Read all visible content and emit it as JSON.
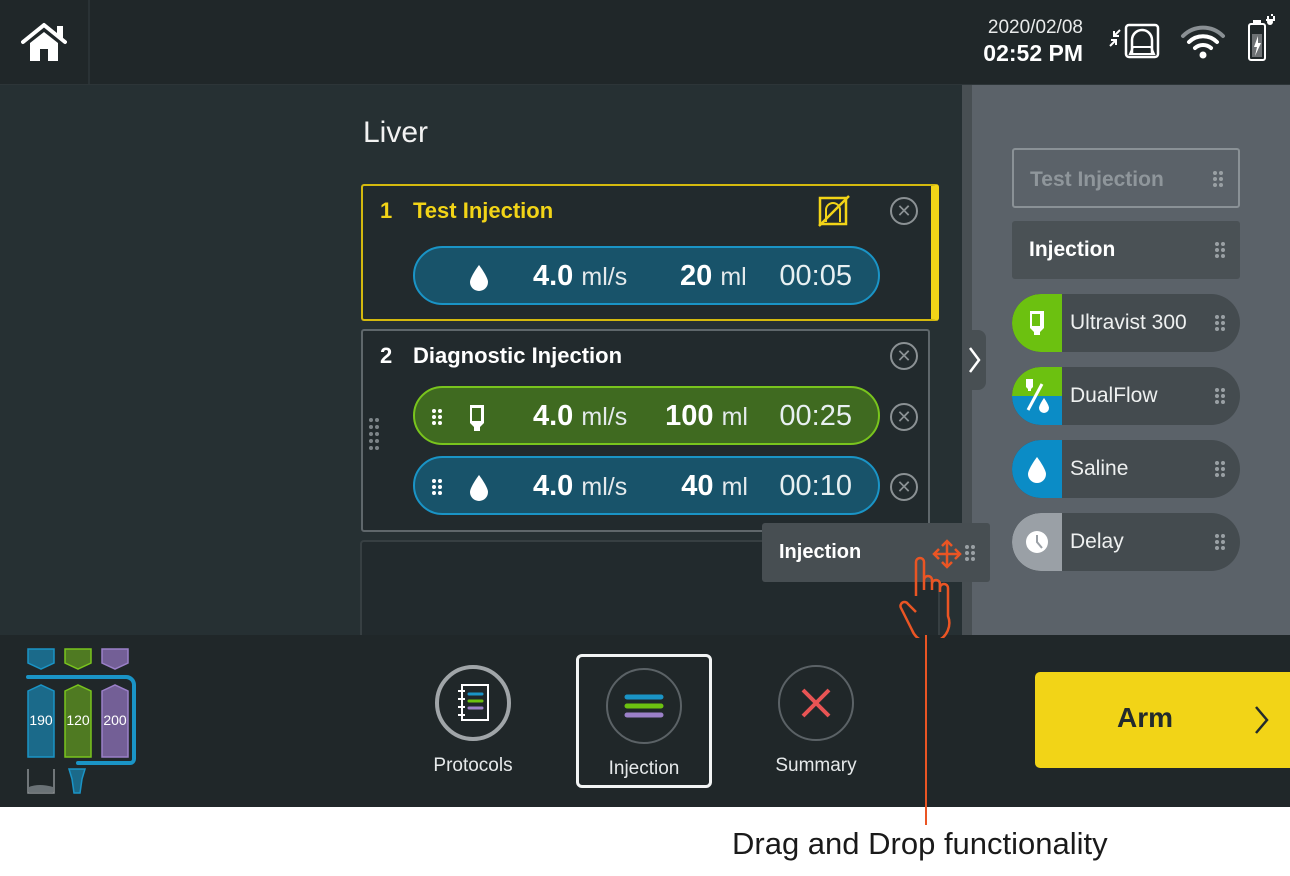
{
  "topbar": {
    "home_icon": "home-icon",
    "date": "2020/02/08",
    "time": "02:52 PM",
    "status_icons": [
      "scanner-link-icon",
      "wifi-icon",
      "battery-charging-icon"
    ]
  },
  "protocol": {
    "title": "Liver",
    "steps": [
      {
        "number": "1",
        "name": "Test Injection",
        "scanner_disabled_icon": "scanner-off-icon",
        "phases": [
          {
            "type": "saline",
            "flow_value": "4.0",
            "flow_unit": "ml/s",
            "volume_value": "20",
            "volume_unit": "ml",
            "duration": "00:05"
          }
        ]
      },
      {
        "number": "2",
        "name": "Diagnostic Injection",
        "phases": [
          {
            "type": "contrast",
            "flow_value": "4.0",
            "flow_unit": "ml/s",
            "volume_value": "100",
            "volume_unit": "ml",
            "duration": "00:25"
          },
          {
            "type": "saline",
            "flow_value": "4.0",
            "flow_unit": "ml/s",
            "volume_value": "40",
            "volume_unit": "ml",
            "duration": "00:10"
          }
        ]
      }
    ]
  },
  "library": {
    "items": [
      {
        "label": "Test Injection",
        "state": "disabled"
      },
      {
        "label": "Injection"
      },
      {
        "label": "Ultravist 300",
        "color": "#6cc110"
      },
      {
        "label": "DualFlow",
        "color_top": "#6cc110",
        "color_bottom": "#0b8cc6"
      },
      {
        "label": "Saline",
        "color": "#0b8cc6"
      },
      {
        "label": "Delay",
        "color": "#9aa0a6"
      }
    ]
  },
  "dragged_item": {
    "label": "Injection"
  },
  "fluid_status": {
    "syringes": [
      {
        "value": "190",
        "color": "#1b6a8a"
      },
      {
        "value": "120",
        "color": "#4f7a22"
      },
      {
        "value": "200",
        "color": "#735f96"
      }
    ]
  },
  "bottom_nav": {
    "tabs": [
      {
        "label": "Protocols",
        "active": false
      },
      {
        "label": "Injection",
        "active": true
      },
      {
        "label": "Summary",
        "active": false
      }
    ],
    "arm_label": "Arm"
  },
  "annotation": {
    "text": "Drag and Drop functionality"
  },
  "colors": {
    "accent_yellow": "#f2d417",
    "saline_blue": "#0b8cc6",
    "contrast_green": "#6cc110",
    "annotation_orange": "#ea5524"
  }
}
